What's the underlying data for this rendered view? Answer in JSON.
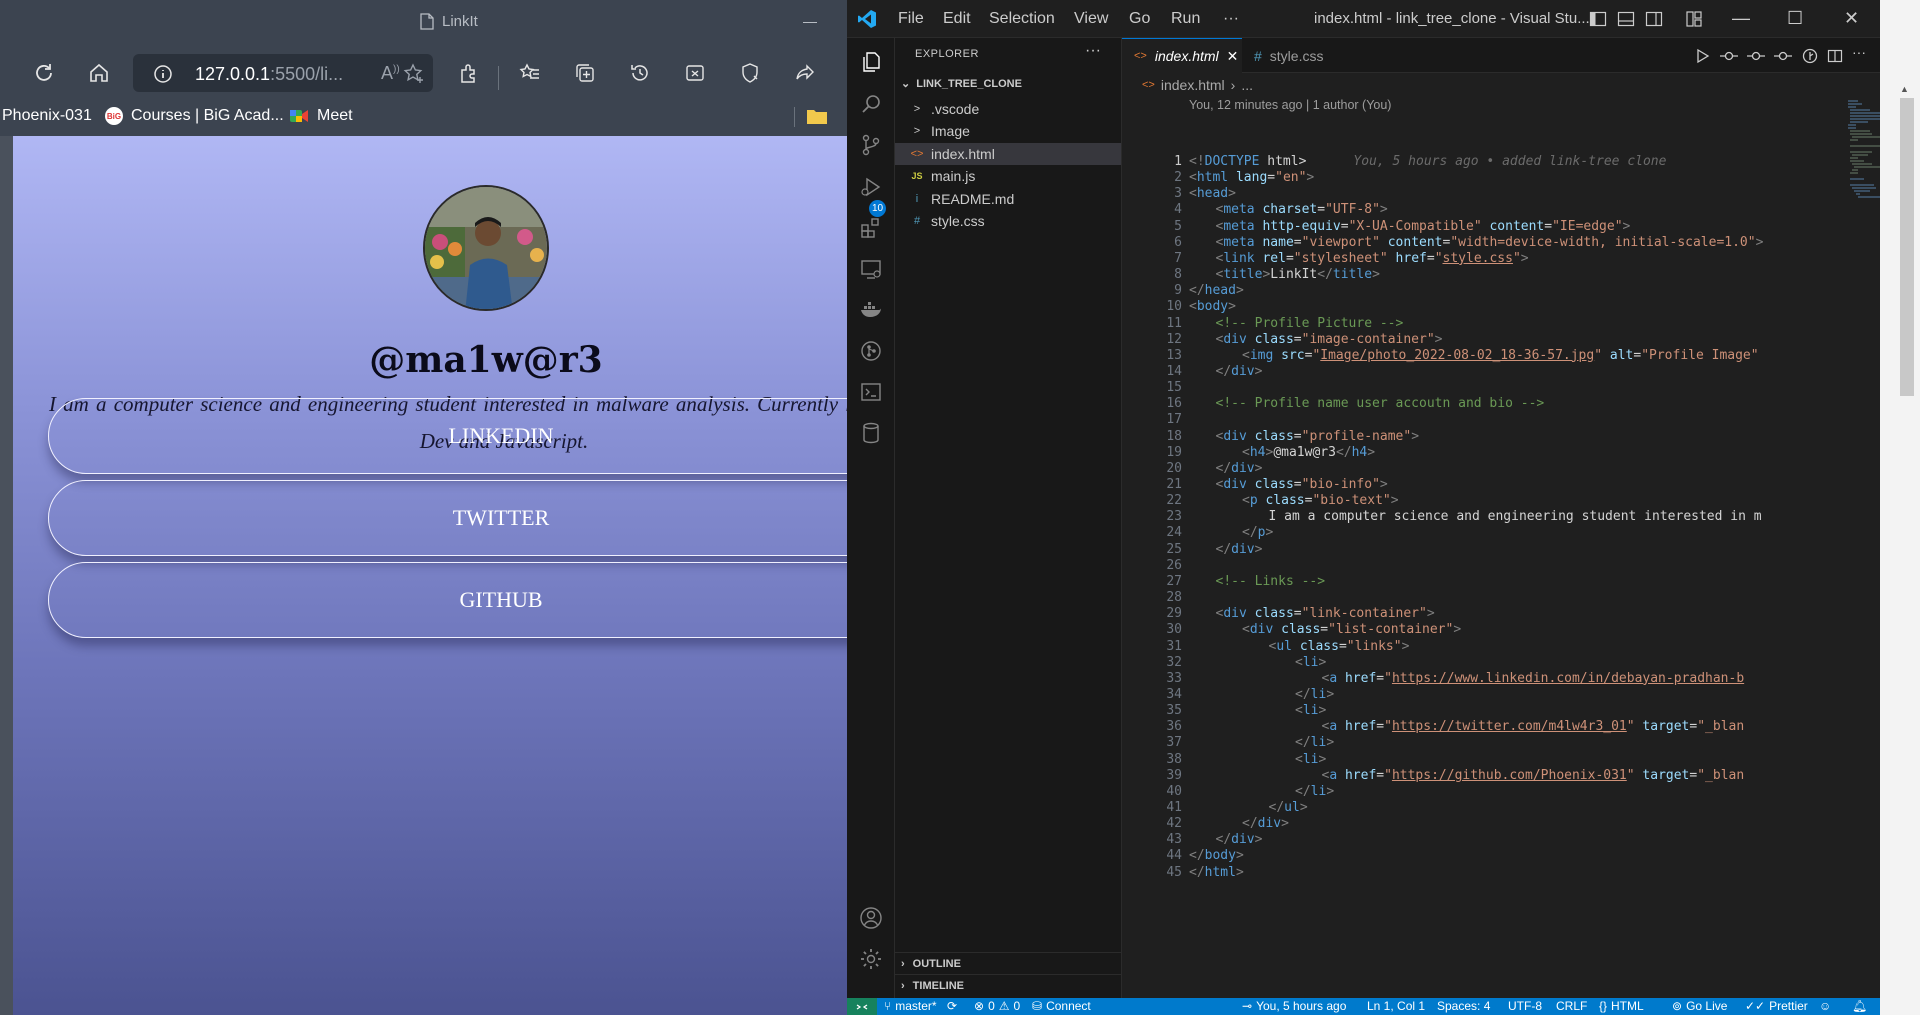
{
  "browser": {
    "tab_title": "LinkIt",
    "address_host": "127.0.0.1",
    "address_rest": ":5500/li...",
    "bookmarks": [
      {
        "label": "Phoenix-031"
      },
      {
        "label": "Courses | BiG Acad..."
      },
      {
        "label": "Meet"
      }
    ],
    "page": {
      "profile_name": "@ma1w@r3",
      "bio": "I am a computer science and engineering student interested in malware analysis. Currently learning Web Dev and Javascript.",
      "links": [
        "LINKEDIN",
        "TWITTER",
        "GITHUB"
      ]
    }
  },
  "vscode": {
    "menu": [
      "File",
      "Edit",
      "Selection",
      "View",
      "Go",
      "Run"
    ],
    "menu_more": "···",
    "window_title": "index.html - link_tree_clone - Visual Stu...",
    "activity_badge": "10",
    "explorer": {
      "title": "EXPLORER",
      "more": "···",
      "root": "LINK_TREE_CLONE",
      "items": [
        {
          "label": ".vscode",
          "icon": ">"
        },
        {
          "label": "Image",
          "icon": ">"
        },
        {
          "label": "index.html",
          "icon": "<>"
        },
        {
          "label": "main.js",
          "icon": "JS"
        },
        {
          "label": "README.md",
          "icon": "i"
        },
        {
          "label": "style.css",
          "icon": "#"
        }
      ],
      "outline": "OUTLINE",
      "timeline": "TIMELINE"
    },
    "tabs": [
      {
        "label": "index.html",
        "icon": "<>"
      },
      {
        "label": "style.css",
        "icon": "#"
      }
    ],
    "breadcrumb": {
      "file": "index.html",
      "rest": "..."
    },
    "blame_header": "You, 12 minutes ago | 1 author (You)",
    "blame_inline": "You, 5 hours ago • added link-tree clone",
    "code_lines": [
      "<!DOCTYPE html>",
      "<html lang=\"en\">",
      "<head>",
      "<meta charset=\"UTF-8\">",
      "<meta http-equiv=\"X-UA-Compatible\" content=\"IE=edge\">",
      "<meta name=\"viewport\" content=\"width=device-width, initial-scale=1.0\">",
      "<link rel=\"stylesheet\" href=\"style.css\">",
      "<title>LinkIt</title>",
      "</head>",
      "<body>",
      "<!-- Profile Picture -->",
      "<div class=\"image-container\">",
      "<img src=\"Image/photo_2022-08-02_18-36-57.jpg\" alt=\"Profile Image\"",
      "</div>",
      "",
      "<!-- Profile name user accoutn and bio -->",
      "",
      "<div class=\"profile-name\">",
      "<h4>@ma1w@r3</h4>",
      "</div>",
      "<div class=\"bio-info\">",
      "<p class=\"bio-text\">",
      "I am a computer science and engineering student interested in m",
      "</p>",
      "</div>",
      "",
      "<!-- Links -->",
      "",
      "<div class=\"link-container\">",
      "<div class=\"list-container\">",
      "<ul class=\"links\">",
      "<li>",
      "<a href=\"https://www.linkedin.com/in/debayan-pradhan-b",
      "</li>",
      "<li>",
      "<a href=\"https://twitter.com/m4lw4r3_01\" target=\"_blan",
      "</li>",
      "<li>",
      "<a href=\"https://github.com/Phoenix-031\" target=\"_blan",
      "</li>",
      "</ul>",
      "</div>",
      "</div>",
      "</body>",
      "</html>"
    ],
    "status": {
      "branch": "master*",
      "problems_errors": "0",
      "problems_warnings": "0",
      "connect": "Connect",
      "blame": "You, 5 hours ago",
      "position": "Ln 1, Col 1",
      "spaces": "Spaces: 4",
      "encoding": "UTF-8",
      "eol": "CRLF",
      "language": "HTML",
      "golive": "Go Live",
      "prettier": "Prettier"
    }
  },
  "colors": {
    "vscode_accent": "#007acc",
    "browser_chrome": "#3c4450",
    "page_gradient_top": "#b0b7f4",
    "page_gradient_bottom": "#4b5391"
  }
}
